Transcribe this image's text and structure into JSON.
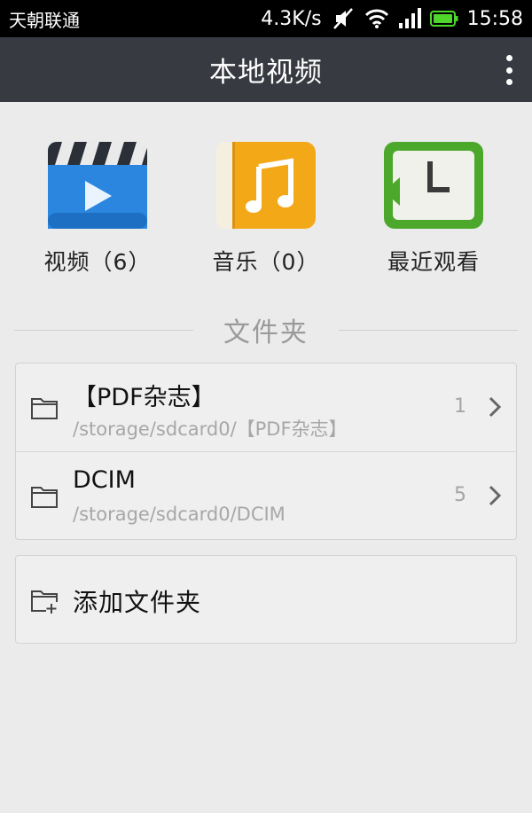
{
  "status_bar": {
    "carrier": "天朝联通",
    "speed": "4.3K/s",
    "time": "15:58",
    "icons": [
      "mute-icon",
      "wifi-icon",
      "signal-icon",
      "battery-icon"
    ]
  },
  "app_bar": {
    "title": "本地视频",
    "menu_icon": "overflow-menu-icon"
  },
  "categories": [
    {
      "label": "视频（6）",
      "icon": "video-clapper-icon"
    },
    {
      "label": "音乐（0）",
      "icon": "music-note-icon"
    },
    {
      "label": "最近观看",
      "icon": "clock-icon"
    }
  ],
  "section": {
    "title": "文件夹"
  },
  "folders": [
    {
      "name": "【PDF杂志】",
      "path": "/storage/sdcard0/【PDF杂志】",
      "count": "1"
    },
    {
      "name": "DCIM",
      "path": "/storage/sdcard0/DCIM",
      "count": "5"
    }
  ],
  "add_folder": {
    "label": "添加文件夹",
    "icon": "add-folder-icon"
  },
  "colors": {
    "status_bar": "#000000",
    "app_bar": "#373a41",
    "background": "#ebebeb",
    "video_icon": "#1e7fd8",
    "music_icon": "#f2a516",
    "clock_icon": "#4faa2c"
  }
}
